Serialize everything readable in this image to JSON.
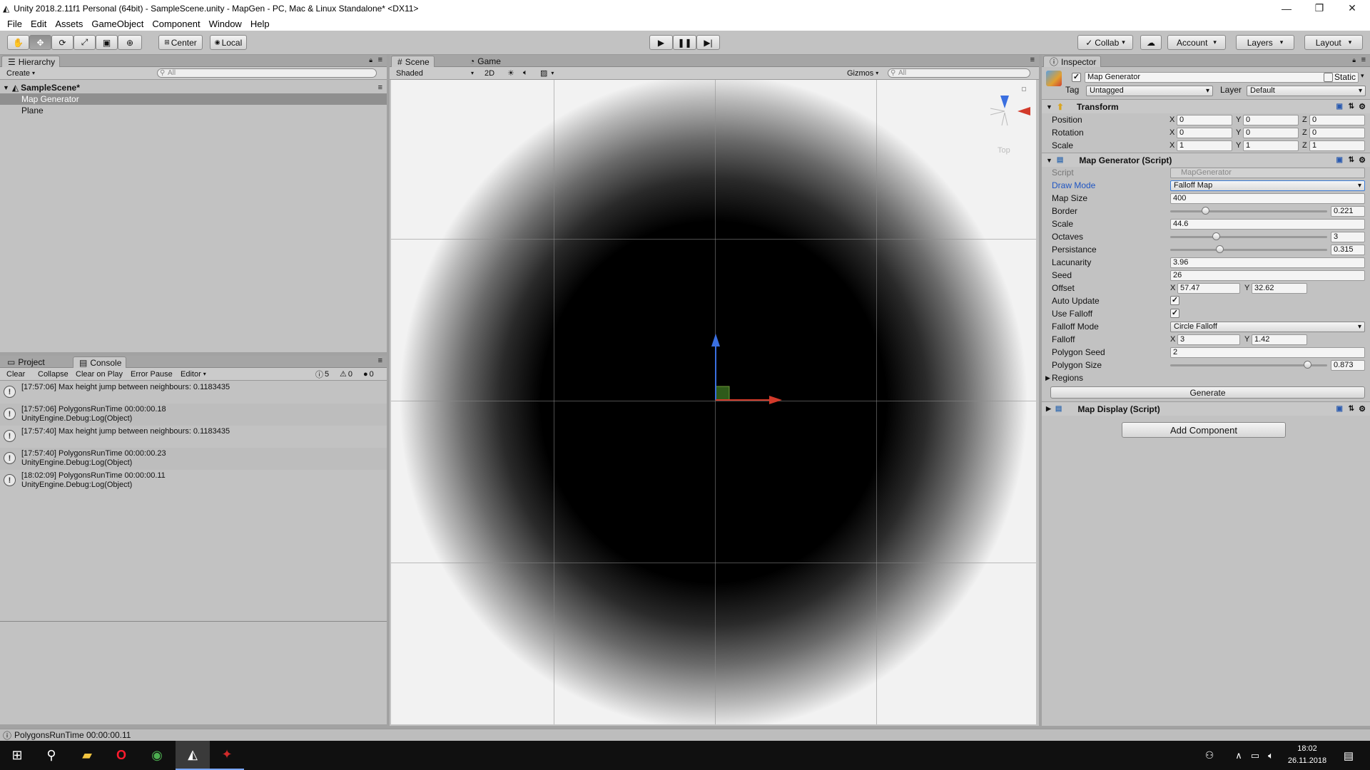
{
  "window": {
    "title": "Unity 2018.2.11f1 Personal (64bit) - SampleScene.unity - MapGen - PC, Mac & Linux Standalone* <DX11>"
  },
  "menu": [
    "File",
    "Edit",
    "Assets",
    "GameObject",
    "Component",
    "Window",
    "Help"
  ],
  "toolbar": {
    "center": "Center",
    "local": "Local",
    "collab": "Collab",
    "account": "Account",
    "layers": "Layers",
    "layout": "Layout"
  },
  "hierarchy": {
    "tab": "Hierarchy",
    "create": "Create",
    "search_placeholder": "All",
    "scene": "SampleScene*",
    "items": [
      "Map Generator",
      "Plane"
    ],
    "selected": "Map Generator"
  },
  "console": {
    "tabs": [
      "Project",
      "Console"
    ],
    "buttons": [
      "Clear",
      "Collapse",
      "Clear on Play",
      "Error Pause",
      "Editor"
    ],
    "counts": {
      "log": "5",
      "warn": "0",
      "error": "0"
    },
    "logs": [
      {
        "line1": "[17:57:06] Max height jump between neighbours: 0.1183435",
        "line2": ""
      },
      {
        "line1": "[17:57:06] PolygonsRunTime 00:00:00.18",
        "line2": "UnityEngine.Debug:Log(Object)"
      },
      {
        "line1": "[17:57:40] Max height jump between neighbours: 0.1183435",
        "line2": ""
      },
      {
        "line1": "[17:57:40] PolygonsRunTime 00:00:00.23",
        "line2": "UnityEngine.Debug:Log(Object)"
      },
      {
        "line1": "[18:02:09] PolygonsRunTime 00:00:00.11",
        "line2": "UnityEngine.Debug:Log(Object)"
      }
    ]
  },
  "scene": {
    "tabs": [
      "Scene",
      "Game"
    ],
    "shading": "Shaded",
    "mode2d": "2D",
    "gizmos": "Gizmos",
    "search_placeholder": "All",
    "gizmo_label": "Top"
  },
  "inspector": {
    "tab": "Inspector",
    "object_name": "Map Generator",
    "static_label": "Static",
    "tag_label": "Tag",
    "tag_value": "Untagged",
    "layer_label": "Layer",
    "layer_value": "Default",
    "transform": {
      "title": "Transform",
      "rows": [
        {
          "label": "Position",
          "x": "0",
          "y": "0",
          "z": "0"
        },
        {
          "label": "Rotation",
          "x": "0",
          "y": "0",
          "z": "0"
        },
        {
          "label": "Scale",
          "x": "1",
          "y": "1",
          "z": "1"
        }
      ]
    },
    "mapgen": {
      "title": "Map Generator (Script)",
      "script_label": "Script",
      "script_value": "MapGenerator",
      "draw_mode_label": "Draw Mode",
      "draw_mode_value": "Falloff Map",
      "map_size_label": "Map Size",
      "map_size_value": "400",
      "border_label": "Border",
      "border_value": "0.221",
      "border_fraction": 0.221,
      "scale_label": "Scale",
      "scale_value": "44.6",
      "octaves_label": "Octaves",
      "octaves_value": "3",
      "octaves_fraction": 0.29,
      "persistance_label": "Persistance",
      "persistance_value": "0.315",
      "persistance_fraction": 0.315,
      "lacunarity_label": "Lacunarity",
      "lacunarity_value": "3.96",
      "seed_label": "Seed",
      "seed_value": "26",
      "offset_label": "Offset",
      "offset_x": "57.47",
      "offset_y": "32.62",
      "auto_update_label": "Auto Update",
      "auto_update": true,
      "use_falloff_label": "Use Falloff",
      "use_falloff": true,
      "falloff_mode_label": "Falloff Mode",
      "falloff_mode_value": "Circle Falloff",
      "falloff_label": "Falloff",
      "falloff_x": "3",
      "falloff_y": "1.42",
      "polygon_seed_label": "Polygon Seed",
      "polygon_seed_value": "2",
      "polygon_size_label": "Polygon Size",
      "polygon_size_value": "0.873",
      "polygon_size_fraction": 0.873,
      "regions_label": "Regions",
      "generate_label": "Generate"
    },
    "mapdisplay": {
      "title": "Map Display (Script)"
    },
    "add_component": "Add Component"
  },
  "status": {
    "text": "PolygonsRunTime 00:00:00.11"
  },
  "taskbar": {
    "time": "18:02",
    "date": "26.11.2018"
  },
  "axis_letters": {
    "x": "X",
    "y": "Y",
    "z": "Z"
  }
}
